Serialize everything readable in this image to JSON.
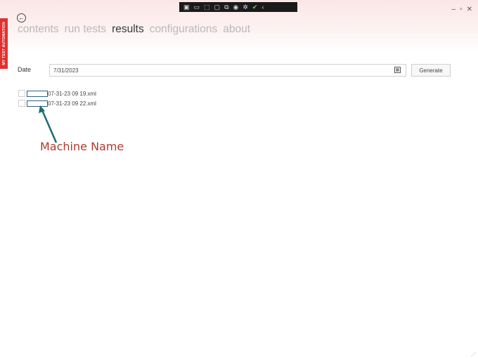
{
  "side_tab": {
    "label": "MY TEST AUTOMATION"
  },
  "window_controls": {
    "minimize": "–",
    "restore": "▫",
    "close": "✕"
  },
  "toolbar_icons": [
    "capture-icon",
    "record-icon",
    "screenshot-icon",
    "window-icon",
    "compare-icon",
    "audio-icon",
    "accessibility-icon",
    "done-icon",
    "collapse-icon"
  ],
  "nav": {
    "items": [
      "contents",
      "run tests",
      "results",
      "configurations",
      "about"
    ],
    "active": "results"
  },
  "date": {
    "label": "Date",
    "value": "7/31/2023"
  },
  "generate": {
    "label": "Generate"
  },
  "results": [
    {
      "file": "07-31-23 09 19.xml"
    },
    {
      "file": "07-31-23 09 22.xml"
    }
  ],
  "annotation": {
    "text": "Machine Name"
  },
  "colors": {
    "accent_red": "#e03131",
    "annotation_red": "#b03a2e",
    "arrow_teal": "#1f6b75"
  }
}
